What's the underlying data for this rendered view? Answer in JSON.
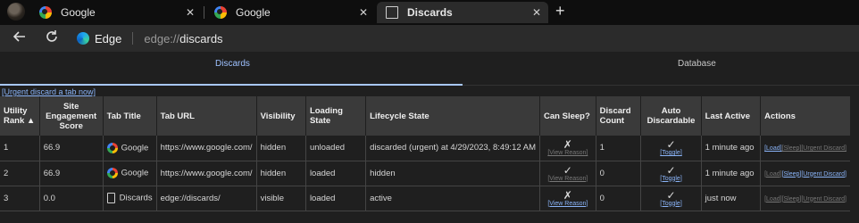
{
  "browser": {
    "tabs": [
      {
        "title": "Google",
        "icon": "google-icon",
        "active": false
      },
      {
        "title": "Google",
        "icon": "google-icon",
        "active": false
      },
      {
        "title": "Discards",
        "icon": "document-icon",
        "active": true
      }
    ],
    "tab_close_glyph": "✕",
    "new_tab_glyph": "+",
    "address": {
      "brand": "Edge",
      "url_scheme": "edge://",
      "url_rest": "discards"
    }
  },
  "page": {
    "tabs": [
      {
        "label": "Discards"
      },
      {
        "label": "Database"
      }
    ],
    "urgent_link": "[Urgent discard a tab now]",
    "columns": {
      "rank": "Utility Rank ▲",
      "engagement": "Site Engagement Score",
      "title": "Tab Title",
      "url": "Tab URL",
      "visibility": "Visibility",
      "loading": "Loading State",
      "lifecycle": "Lifecycle State",
      "can_sleep": "Can Sleep?",
      "discard_count": "Discard Count",
      "auto_discardable": "Auto Discardable",
      "last_active": "Last Active",
      "actions": "Actions"
    },
    "rows": [
      {
        "rank": "1",
        "score": "66.9",
        "title": "Google",
        "icon": "google-icon",
        "url": "https://www.google.com/",
        "visibility": "hidden",
        "loading": "unloaded",
        "lifecycle": "discarded (urgent) at 4/29/2023, 8:49:12 AM",
        "can_sleep": "✗",
        "view_reason": "[View Reason]",
        "discard_count": "1",
        "auto": "✓",
        "toggle": "[Toggle]",
        "last_active": "1 minute ago",
        "act_load": "[Load]",
        "act_sleep": "[Sleep]",
        "act_urgent": "[Urgent Discard]"
      },
      {
        "rank": "2",
        "score": "66.9",
        "title": "Google",
        "icon": "google-icon",
        "url": "https://www.google.com/",
        "visibility": "hidden",
        "loading": "loaded",
        "lifecycle": "hidden",
        "can_sleep": "✓",
        "view_reason": "[View Reason]",
        "discard_count": "0",
        "auto": "✓",
        "toggle": "[Toggle]",
        "last_active": "1 minute ago",
        "act_load": "[Load]",
        "act_sleep": "[Sleep]",
        "act_urgent": "[Urgent Discard]"
      },
      {
        "rank": "3",
        "score": "0.0",
        "title": "Discards",
        "icon": "document-icon",
        "url": "edge://discards/",
        "visibility": "visible",
        "loading": "loaded",
        "lifecycle": "active",
        "can_sleep": "✗",
        "view_reason": "[View Reason]",
        "discard_count": "0",
        "auto": "✓",
        "toggle": "[Toggle]",
        "last_active": "just now",
        "act_load": "[Load]",
        "act_sleep": "[Sleep]",
        "act_urgent": "[Urgent Discard]"
      }
    ]
  }
}
